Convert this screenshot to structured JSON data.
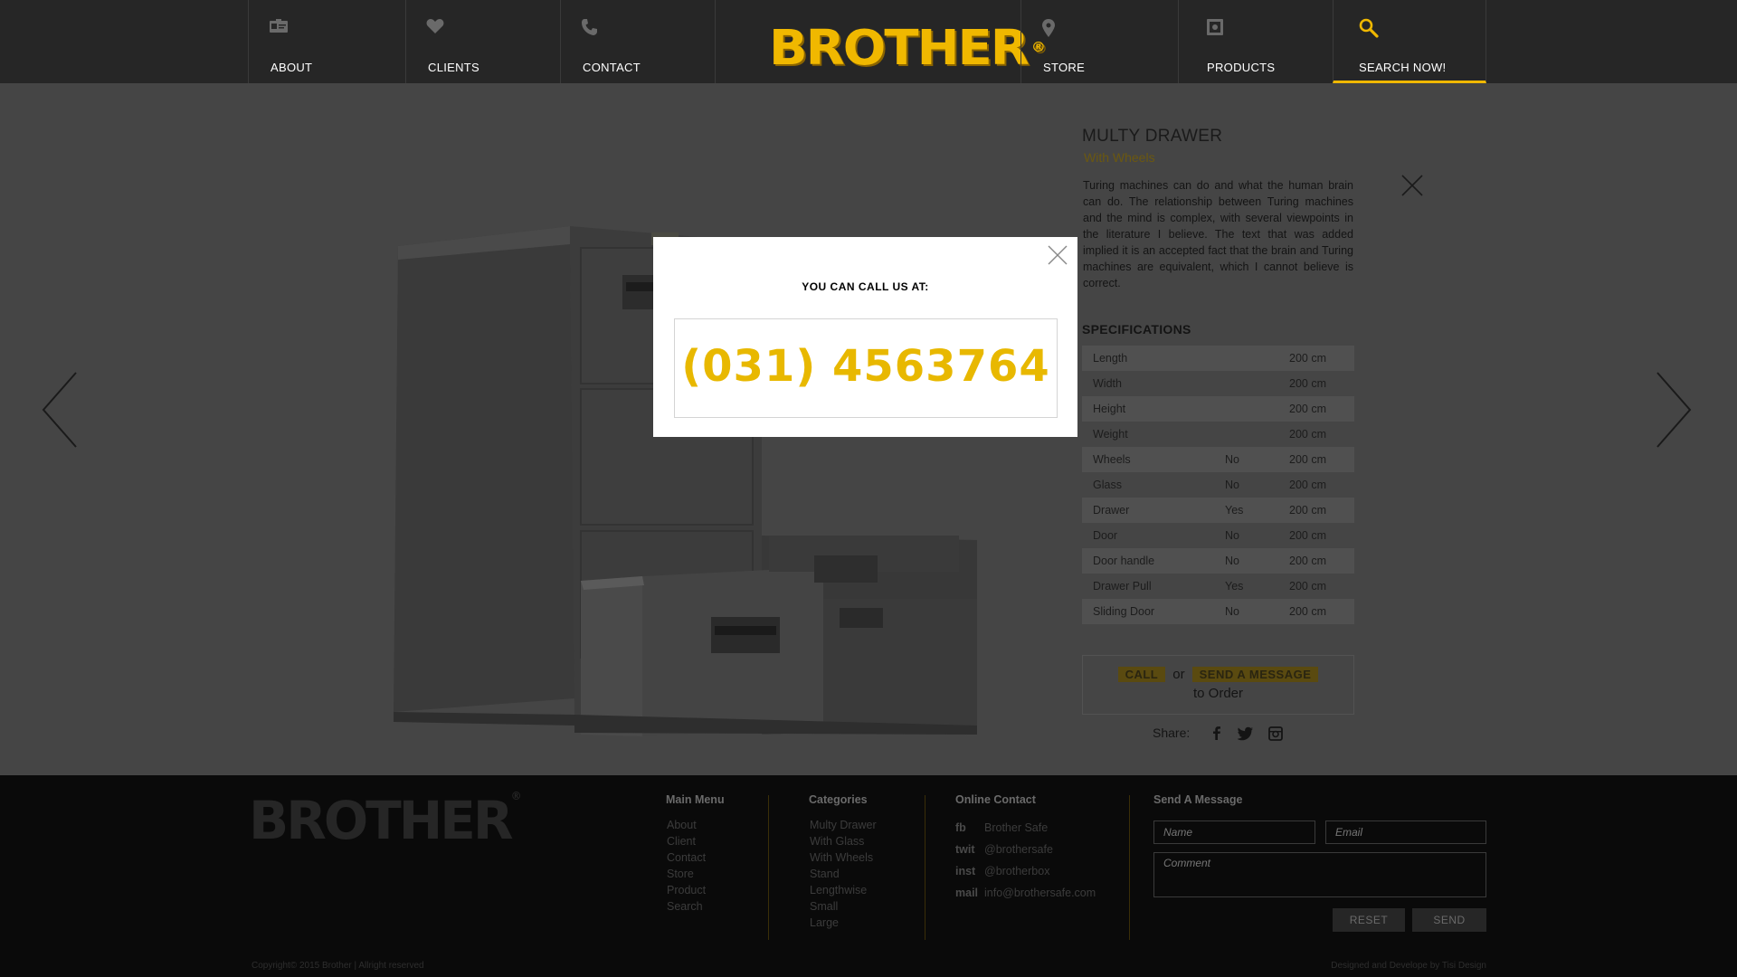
{
  "nav": {
    "items": [
      {
        "label": "ABOUT",
        "icon": "id-card-icon"
      },
      {
        "label": "CLIENTS",
        "icon": "heart-icon"
      },
      {
        "label": "CONTACT",
        "icon": "phone-icon"
      },
      {
        "label": "STORE",
        "icon": "map-pin-icon"
      },
      {
        "label": "PRODUCTS",
        "icon": "safe-icon"
      },
      {
        "label": "SEARCH NOW!",
        "icon": "search-icon"
      }
    ],
    "active": "SEARCH NOW!",
    "logo": "BROTHER",
    "logo_mark": "®",
    "accent": "#f0b800"
  },
  "product": {
    "title": "MULTY DRAWER",
    "subtitle": "With Wheels",
    "description": "Turing machines can do and what the human brain can do. The relationship between Turing machines and the mind is complex, with several viewpoints in the literature I believe. The text that was added implied it is an accepted fact that the brain and Turing machines are equivalent, which I cannot believe is correct.",
    "specs_title": "SPECIFICATIONS",
    "specs": [
      {
        "name": "Length",
        "value": "",
        "size": "200 cm"
      },
      {
        "name": "Width",
        "value": "",
        "size": "200 cm"
      },
      {
        "name": "Height",
        "value": "",
        "size": "200 cm"
      },
      {
        "name": "Weight",
        "value": "",
        "size": "200 cm"
      },
      {
        "name": "Wheels",
        "value": "No",
        "size": "200 cm"
      },
      {
        "name": "Glass",
        "value": "No",
        "size": "200 cm"
      },
      {
        "name": "Drawer",
        "value": "Yes",
        "size": "200 cm"
      },
      {
        "name": "Door",
        "value": "No",
        "size": "200 cm"
      },
      {
        "name": "Door handle",
        "value": "No",
        "size": "200 cm"
      },
      {
        "name": "Drawer Pull",
        "value": "Yes",
        "size": "200 cm"
      },
      {
        "name": "Sliding Door",
        "value": "No",
        "size": "200 cm"
      }
    ],
    "order": {
      "call_label": "CALL",
      "or_label": "or",
      "message_label": "SEND A MESSAGE",
      "to_order_label": "to Order"
    },
    "share_label": "Share:"
  },
  "modal": {
    "title": "YOU CAN CALL US AT:",
    "phone": "(031) 4563764"
  },
  "footer": {
    "logo": "BROTHER",
    "logo_mark": "®",
    "main_menu": {
      "title": "Main Menu",
      "links": [
        "About",
        "Client",
        "Contact",
        "Store",
        "Product",
        "Search"
      ]
    },
    "categories": {
      "title": "Categories",
      "links": [
        "Multy Drawer",
        "With Glass",
        "With Wheels",
        "Stand",
        "Lengthwise",
        "Small",
        "Large"
      ]
    },
    "online_contact": {
      "title": "Online Contact",
      "items": [
        {
          "key": "fb",
          "value": "Brother Safe"
        },
        {
          "key": "twit",
          "value": "@brothersafe"
        },
        {
          "key": "inst",
          "value": "@brotherbox"
        },
        {
          "key": "mail",
          "value": "info@brothersafe.com"
        }
      ]
    },
    "message": {
      "title": "Send A Message",
      "name_placeholder": "Name",
      "email_placeholder": "Email",
      "comment_placeholder": "Comment",
      "reset_label": "RESET",
      "send_label": "SEND"
    },
    "copyright": "Copyright© 2015 Brother | Allright reserved",
    "credit": "Designed and Develope by Tisi Design"
  }
}
